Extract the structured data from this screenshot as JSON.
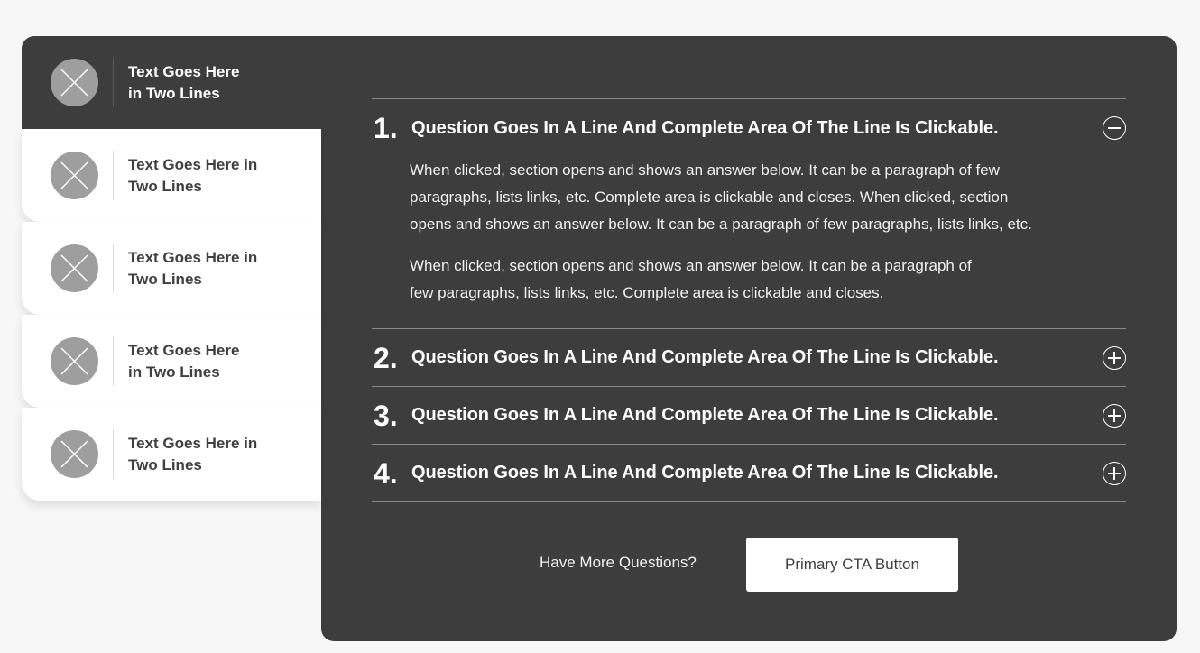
{
  "tabs": [
    {
      "label": "Text Goes Here\nin Two Lines",
      "active": true
    },
    {
      "label": "Text Goes Here in\nTwo Lines",
      "active": false
    },
    {
      "label": "Text Goes Here in\nTwo Lines",
      "active": false
    },
    {
      "label": "Text Goes Here\nin Two Lines",
      "active": false
    },
    {
      "label": "Text Goes Here in\nTwo Lines",
      "active": false
    }
  ],
  "faq": [
    {
      "number": "1.",
      "question": "Question Goes In A Line And Complete Area Of The Line Is Clickable.",
      "expanded": true,
      "answer": [
        "When clicked, section opens and shows an answer below. It can be a paragraph of few\nparagraphs, lists links, etc. Complete area is clickable and closes. When clicked, section\nopens and shows an answer below. It can be a paragraph of few paragraphs, lists links, etc.",
        "When clicked, section opens and shows an answer below. It can be a paragraph of\nfew paragraphs, lists links, etc. Complete area is clickable and closes."
      ]
    },
    {
      "number": "2.",
      "question": "Question Goes In A Line And Complete Area Of The Line Is Clickable.",
      "expanded": false
    },
    {
      "number": "3.",
      "question": "Question Goes In A Line And Complete Area Of The Line Is Clickable.",
      "expanded": false
    },
    {
      "number": "4.",
      "question": "Question Goes In A Line And Complete Area Of The Line Is Clickable.",
      "expanded": false
    }
  ],
  "footer": {
    "prompt": "Have More Questions?",
    "cta_label": "Primary CTA Button"
  },
  "icons": {
    "tab_icon": "image-placeholder-icon",
    "expanded": "minus-circle-icon",
    "collapsed": "plus-circle-icon"
  },
  "colors": {
    "panel": "#3d3d3d",
    "tab_background": "#ffffff",
    "placeholder": "#9e9e9e",
    "cta_background": "#ffffff"
  }
}
